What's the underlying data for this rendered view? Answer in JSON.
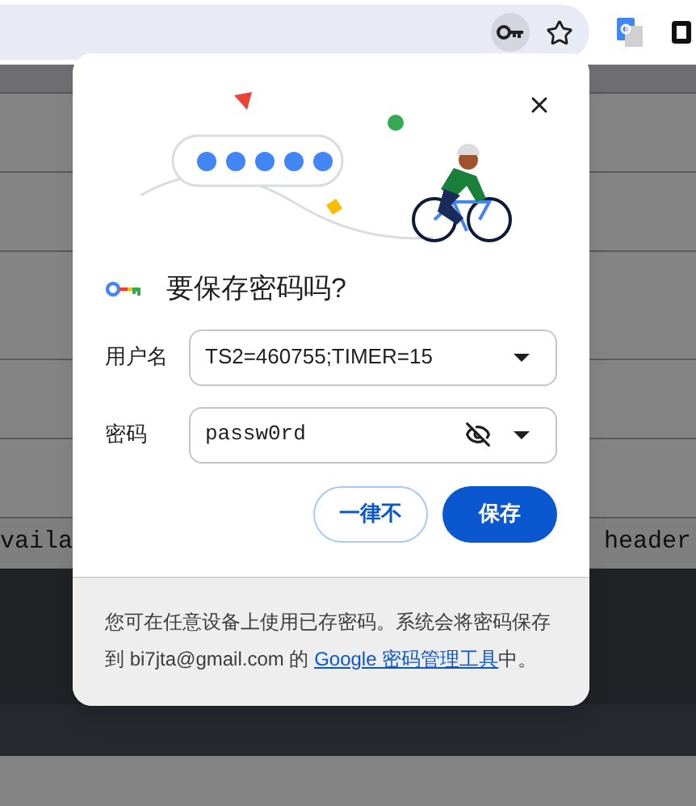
{
  "page": {
    "rows": [
      {
        "kind": "band"
      },
      {
        "kind": "row"
      },
      {
        "kind": "row"
      },
      {
        "kind": "wide"
      },
      {
        "kind": "row"
      },
      {
        "kind": "row"
      },
      {
        "kind": "text",
        "left": "vaila",
        "right": "header"
      },
      {
        "kind": "dark"
      },
      {
        "kind": "bar"
      },
      {
        "kind": "row"
      }
    ]
  },
  "dialog": {
    "title": "要保存密码吗?",
    "fields": [
      {
        "label": "用户名",
        "value": "TS2=460755;TIMER=15",
        "kind": "text"
      },
      {
        "label": "密码",
        "value": "passw0rd",
        "kind": "password"
      }
    ],
    "buttons": [
      {
        "label": "一律不",
        "kind": "secondary"
      },
      {
        "label": "保存",
        "kind": "primary"
      }
    ],
    "footer": {
      "text": "您可在任意设备上使用已存密码。系统会将密码保存到 bi7jta@gmail.com 的 ",
      "link": "Google 密码管理工具",
      "after": "中。"
    }
  }
}
